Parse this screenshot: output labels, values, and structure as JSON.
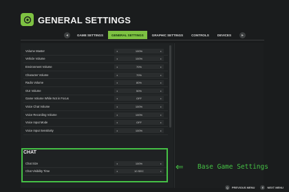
{
  "header": {
    "title": "GENERAL SETTINGS"
  },
  "tabs": [
    {
      "label": "GAME SETTINGS",
      "active": false
    },
    {
      "label": "GENERAL SETTINGS",
      "active": true
    },
    {
      "label": "GRAPHIC SETTINGS",
      "active": false
    },
    {
      "label": "CONTROLS",
      "active": false
    },
    {
      "label": "DEVICES",
      "active": false
    }
  ],
  "tab_nav": {
    "left_key": "◂",
    "right_key": "▸"
  },
  "settings": [
    {
      "label": "Volume Master",
      "value": "100%"
    },
    {
      "label": "Vehicle Volume",
      "value": "100%"
    },
    {
      "label": "Environment Volume",
      "value": "70%"
    },
    {
      "label": "Character Volume",
      "value": "70%"
    },
    {
      "label": "Radio Volume",
      "value": "80%"
    },
    {
      "label": "GUI Volume",
      "value": "50%"
    },
    {
      "label": "Game Volume While Not in Focus",
      "value": "OFF"
    },
    {
      "label": "Voice Chat Volume",
      "value": "100%"
    },
    {
      "label": "Voice Recording Volume",
      "value": "100%"
    },
    {
      "label": "Voice Input Mode",
      "value": "OFF"
    },
    {
      "label": "Voice Input Sensitivity",
      "value": "100%"
    }
  ],
  "chat": {
    "title": "CHAT",
    "rows": [
      {
        "label": "Chat Size",
        "value": "100%"
      },
      {
        "label": "Chat Visibility Time",
        "value": "10 SEC"
      }
    ]
  },
  "annotation": {
    "arrow": "⇐",
    "text": "Base Game Settings"
  },
  "bottom_bar": {
    "previous_key": "Q",
    "previous_label": "PREVIOUS MENU",
    "next_key": "E",
    "next_label": "NEXT MENU"
  },
  "colors": {
    "accent": "#7ec242",
    "annotation": "#45c145",
    "background": "#1a1c1d"
  }
}
